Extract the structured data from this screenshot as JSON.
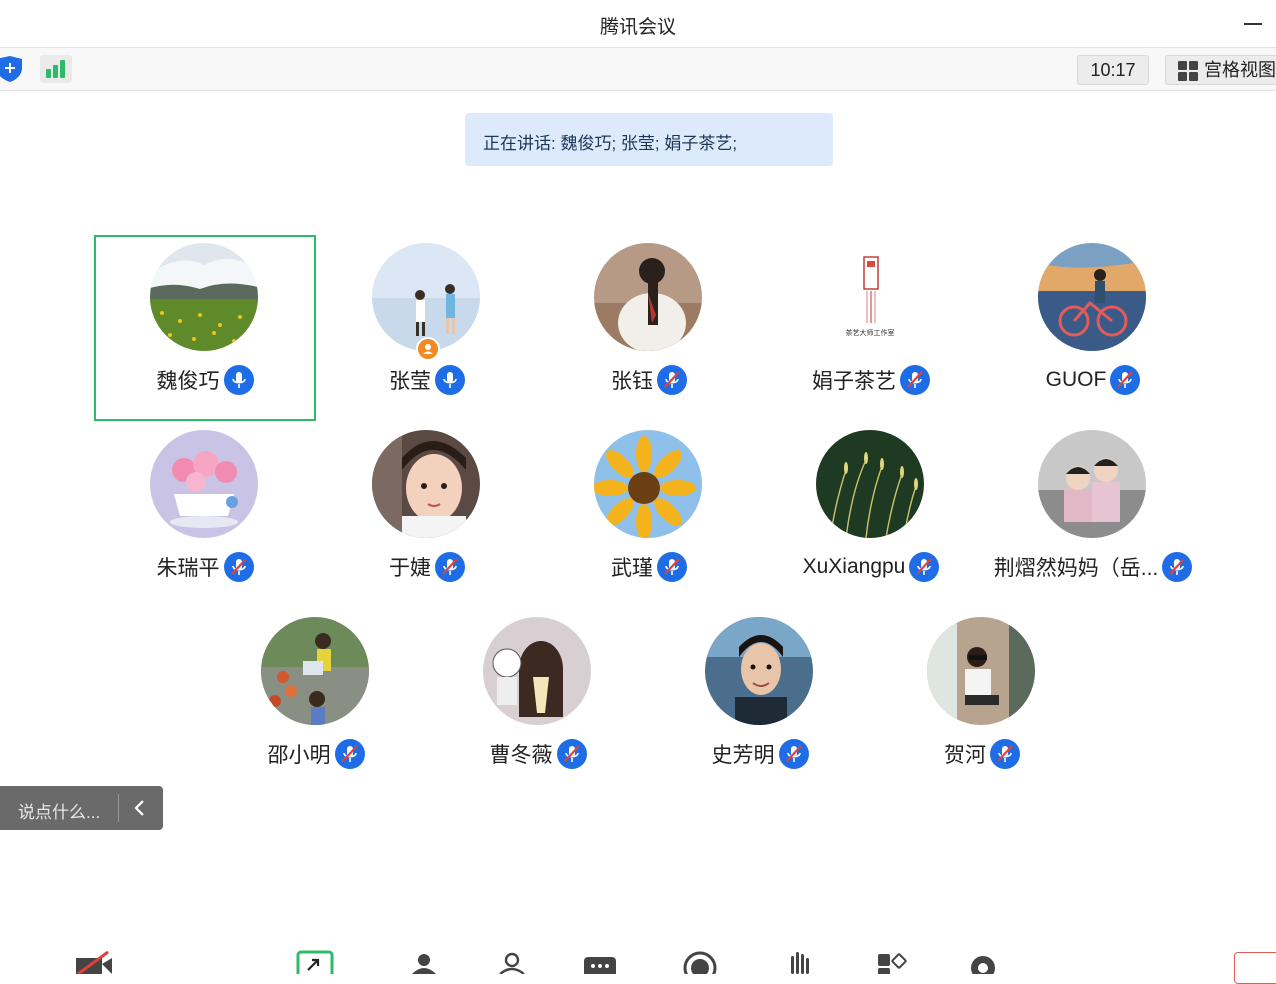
{
  "window": {
    "title": "腾讯会议"
  },
  "toolbar": {
    "time": "10:17",
    "view_button": "宫格视图",
    "colors": {
      "shield": "#1e6de6",
      "signal": "#2dbb6a"
    }
  },
  "speaking": {
    "text": "正在讲话: 魏俊巧; 张莹; 娟子茶艺;"
  },
  "participants": [
    {
      "name": "魏俊巧",
      "mic": "on",
      "avatar": "field-landscape"
    },
    {
      "name": "张莹",
      "mic": "on",
      "avatar": "couple-beach",
      "host_badge": true
    },
    {
      "name": "张钰",
      "mic": "muted",
      "avatar": "girl-back"
    },
    {
      "name": "娟子茶艺",
      "mic": "muted",
      "avatar": "seal-logo",
      "logo_text": "茶艺大师工作室"
    },
    {
      "name": "GUOF",
      "mic": "muted",
      "avatar": "bicycle-sunset"
    },
    {
      "name": "朱瑞平",
      "mic": "muted",
      "avatar": "flowers-cup"
    },
    {
      "name": "于婕",
      "mic": "muted",
      "avatar": "child-face"
    },
    {
      "name": "武瑾",
      "mic": "muted",
      "avatar": "sunflower"
    },
    {
      "name": "XuXiangpu",
      "mic": "muted",
      "avatar": "grass"
    },
    {
      "name": "荆熠然妈妈（岳...",
      "mic": "muted",
      "avatar": "two-kids"
    },
    {
      "name": "邵小明",
      "mic": "muted",
      "avatar": "kids-playing"
    },
    {
      "name": "曹冬薇",
      "mic": "muted",
      "avatar": "girl-bow"
    },
    {
      "name": "史芳明",
      "mic": "muted",
      "avatar": "man-selfie"
    },
    {
      "name": "贺河",
      "mic": "muted",
      "avatar": "woman-sunglasses"
    }
  ],
  "chat": {
    "placeholder": "说点什么..."
  },
  "bottom_toolbar": {
    "icons": [
      "camera-off-icon",
      "share-screen-icon",
      "invite-icon",
      "participants-icon",
      "chat-icon",
      "record-icon",
      "raise-hand-icon",
      "apps-icon",
      "settings-icon"
    ]
  }
}
